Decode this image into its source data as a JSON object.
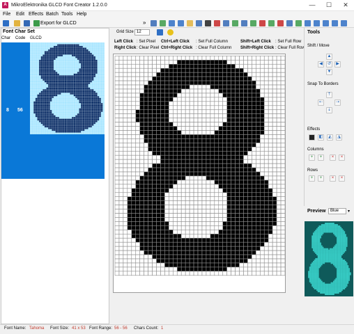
{
  "window": {
    "title": "MikroElektronika GLCD Font Creator 1.2.0.0",
    "app_icon": "A",
    "minimize_glyph": "—",
    "maximize_glyph": "☐",
    "close_glyph": "✕"
  },
  "menu": {
    "items": [
      {
        "label": "File"
      },
      {
        "label": "Edit"
      },
      {
        "label": "Effects"
      },
      {
        "label": "Batch"
      },
      {
        "label": "Tools"
      },
      {
        "label": "Help"
      }
    ]
  },
  "toolbar": {
    "export_label": "Export for GLCD",
    "overflow": "»"
  },
  "charset": {
    "title": "Font Char Set",
    "columns": [
      "Char",
      "Code",
      "GLCD"
    ],
    "row": {
      "char": "8",
      "code": "56"
    }
  },
  "editor": {
    "grid_size_label": "Grid Size",
    "grid_size_value": "12",
    "help": {
      "left_click": "Left Click",
      "set_pixel": ": Set Pixel",
      "ctrl_left": "Ctrl+Left Click",
      "set_full_column": ": Set Full Column",
      "shift_left": "Shift+Left Click",
      "set_full_row": ": Set Full Row",
      "right_click": "Right Click",
      "clear_pixel": ": Clear Pixel",
      "ctrl_right": "Ctrl+Right Click",
      "clear_full_column": ": Clear Full Column",
      "shift_right": "Shift+Right Click",
      "clear_full_row": ": Clear Full Row"
    }
  },
  "tools": {
    "title": "Tools",
    "shift_move": "Shift / Move",
    "snap_to_borders": "Snap To Borders",
    "effects": "Effects",
    "columns": "Columns",
    "rows": "Rows"
  },
  "preview": {
    "title": "Preview",
    "color_option": "Blue"
  },
  "status": {
    "font_name_label": "Font Name:",
    "font_name": "Tahoma",
    "font_size_label": "Font Size:",
    "font_size": "41 x 53",
    "font_range_label": "Font Range:",
    "font_range": "56 - 56",
    "chars_count_label": "Chars Count:",
    "chars_count": "1"
  },
  "colors": {
    "accent": "#0a78d7",
    "pixel_on": "#000000",
    "preview_bg": "#0f5a5a",
    "preview_fg": "#36c9c2",
    "status_value": "#c0392b"
  }
}
